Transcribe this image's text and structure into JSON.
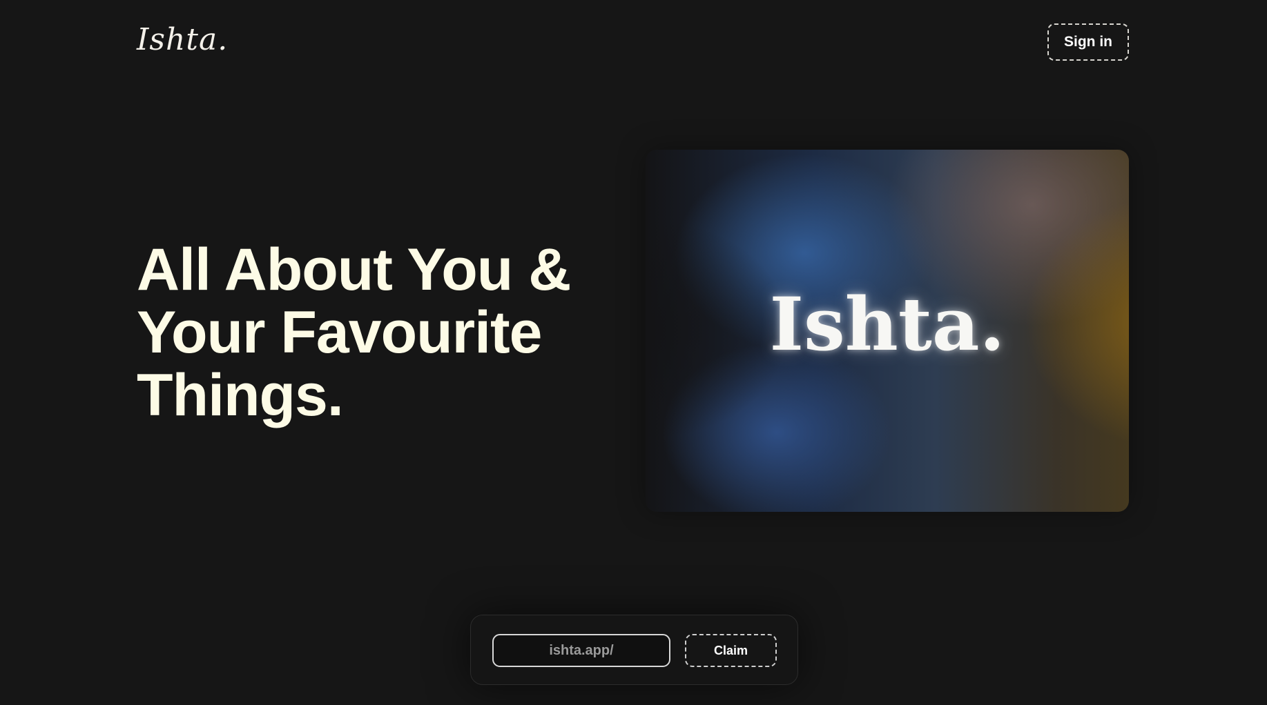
{
  "header": {
    "logo_text": "Ishta.",
    "signin_label": "Sign in"
  },
  "hero": {
    "headline_lines": [
      "All About You &",
      "Your Favourite",
      "Things."
    ],
    "card_wordmark": "Ishta."
  },
  "claim": {
    "input_value": "ishta.app/",
    "button_label": "Claim"
  },
  "colors": {
    "background": "#161616",
    "headline": "#fdfbe6",
    "card_blue": "#34609c",
    "card_gold": "#8f6716"
  }
}
